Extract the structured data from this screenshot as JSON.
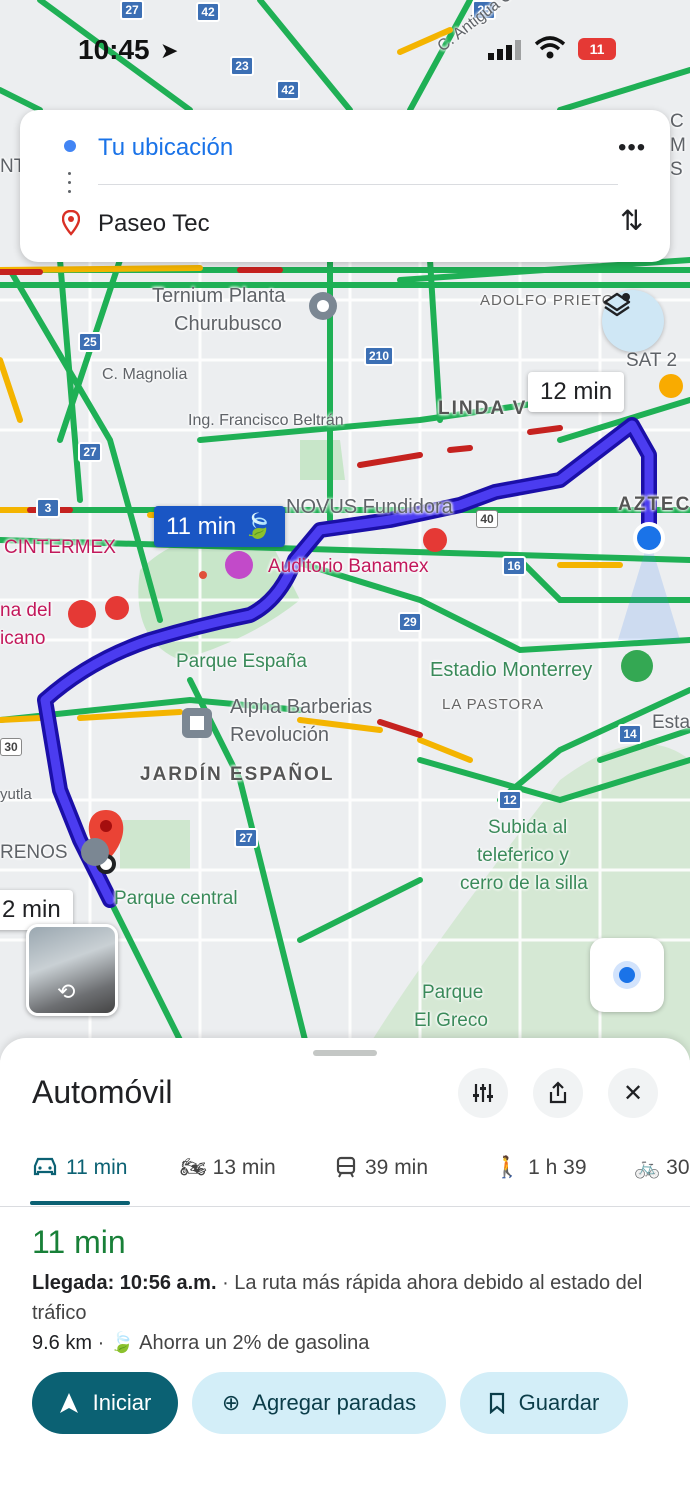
{
  "status_bar": {
    "time": "10:45",
    "battery": "11"
  },
  "directions": {
    "origin": "Tu ubicación",
    "destination": "Paseo Tec"
  },
  "map": {
    "route_labels": {
      "selected": "11 min",
      "alt_right": "12 min",
      "alt_left": "2 min"
    },
    "labels": {
      "ternium": "Ternium Planta",
      "churubusco": "Churubusco",
      "adolfo": "ADOLFO PRIETO",
      "sat": "SAT 2",
      "magnolia": "C. Magnolia",
      "beltran": "Ing. Francisco Beltrán",
      "linda": "LINDA V",
      "azteca": "AZTEC",
      "novus": "NOVUS Fundidora",
      "cintermex": "CINTERMEX",
      "auditorio": "Auditorio Banamex",
      "parque_espana": "Parque España",
      "estadio": "Estadio Monterrey",
      "la_pastora": "LA PASTORA",
      "alpha": "Alpha Barberias",
      "revolucion": "Revolución",
      "jardin": "JARDÍN ESPAÑOL",
      "subida1": "Subida al",
      "subida2": "teleferico y",
      "subida3": "cerro de la silla",
      "parque_central": "Parque central",
      "parque_greco1": "Parque",
      "parque_greco2": "El Greco",
      "renos": "RENOS",
      "yutla": "yutla",
      "del": "na del",
      "icano": "icano",
      "antigua": "C. Antigua Camino",
      "esta": "Esta",
      "nt": "NT",
      "cm": "C M S"
    },
    "shields": [
      "27",
      "42",
      "23",
      "42",
      "25",
      "25",
      "210",
      "27",
      "3",
      "40",
      "16",
      "29",
      "14",
      "12",
      "27",
      "30"
    ]
  },
  "sheet": {
    "title": "Automóvil",
    "tabs": [
      {
        "icon": "car-icon",
        "label": "11 min"
      },
      {
        "icon": "motorcycle-icon",
        "label": "13 min"
      },
      {
        "icon": "transit-icon",
        "label": "39 min"
      },
      {
        "icon": "walk-icon",
        "label": "1 h 39"
      },
      {
        "icon": "bike-icon",
        "label": "30"
      }
    ],
    "eta": "11 min",
    "arrival_label": "Llegada: 10:56 a.m.",
    "arrival_note": " · La ruta más rápida ahora debido al estado del tráfico",
    "distance": "9.6 km",
    "savings": "Ahorra un 2% de gasolina",
    "buttons": {
      "start": "Iniciar",
      "add_stops": "Agregar paradas",
      "save": "Guardar"
    }
  },
  "colors": {
    "route": "#3b2fd8",
    "traffic_green": "#1fb055",
    "traffic_yellow": "#f4b400",
    "traffic_red": "#c5221f",
    "accent": "#0b6173"
  }
}
